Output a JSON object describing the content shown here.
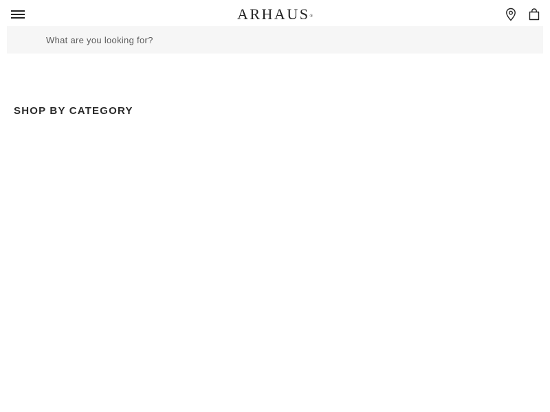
{
  "header": {
    "menu_icon": "hamburger-menu-icon",
    "logo_text": "ARHAUS",
    "logo_mark": "®",
    "store_icon": "location-pin-icon",
    "cart_icon": "shopping-bag-icon"
  },
  "search": {
    "placeholder": "What are you looking for?"
  },
  "main": {
    "section_title": "SHOP BY CATEGORY"
  },
  "colors": {
    "text": "#222222",
    "search_bg": "#f6f6f6",
    "background": "#ffffff"
  }
}
